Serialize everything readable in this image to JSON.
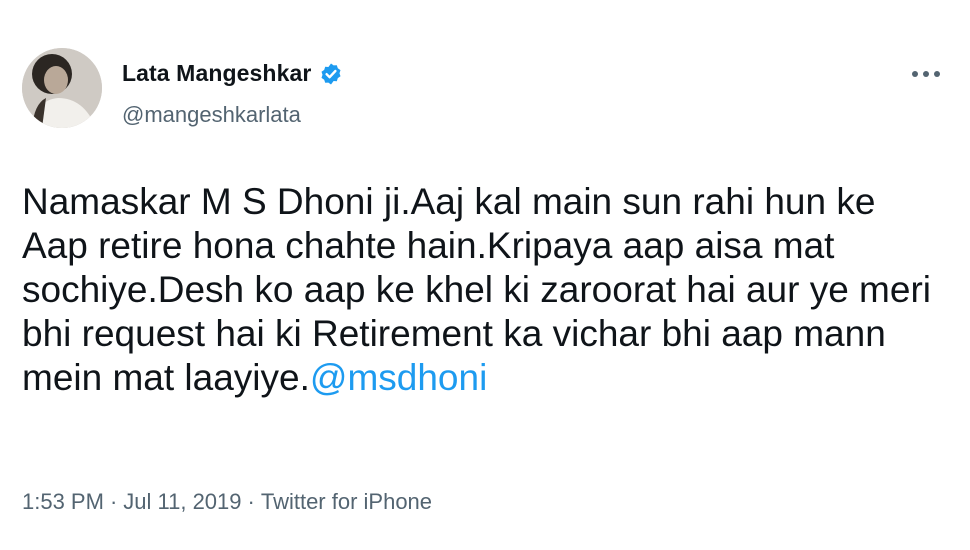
{
  "author": {
    "display_name": "Lata Mangeshkar",
    "handle": "@mangeshkarlata",
    "verified": true,
    "avatar_icon": "profile-photo",
    "verified_color": "#1d9bf0"
  },
  "tweet": {
    "text_lines": [
      "Namaskar M S Dhoni ji.Aaj kal main sun rahi hun ke",
      "Aap retire hona chahte hain.Kripaya aap aisa mat",
      "sochiye.Desh ko aap ke khel ki zaroorat hai aur ye meri",
      "bhi request hai ki Retirement ka vichar bhi aap mann",
      "mein mat laayiye."
    ],
    "mention": "@msdhoni",
    "mention_color": "#1d9bf0"
  },
  "meta": {
    "time": "1:53 PM",
    "separator": "·",
    "date": "Jul 11, 2019",
    "source": "Twitter for iPhone"
  },
  "menu": {
    "icon": "more-horizontal-icon"
  }
}
